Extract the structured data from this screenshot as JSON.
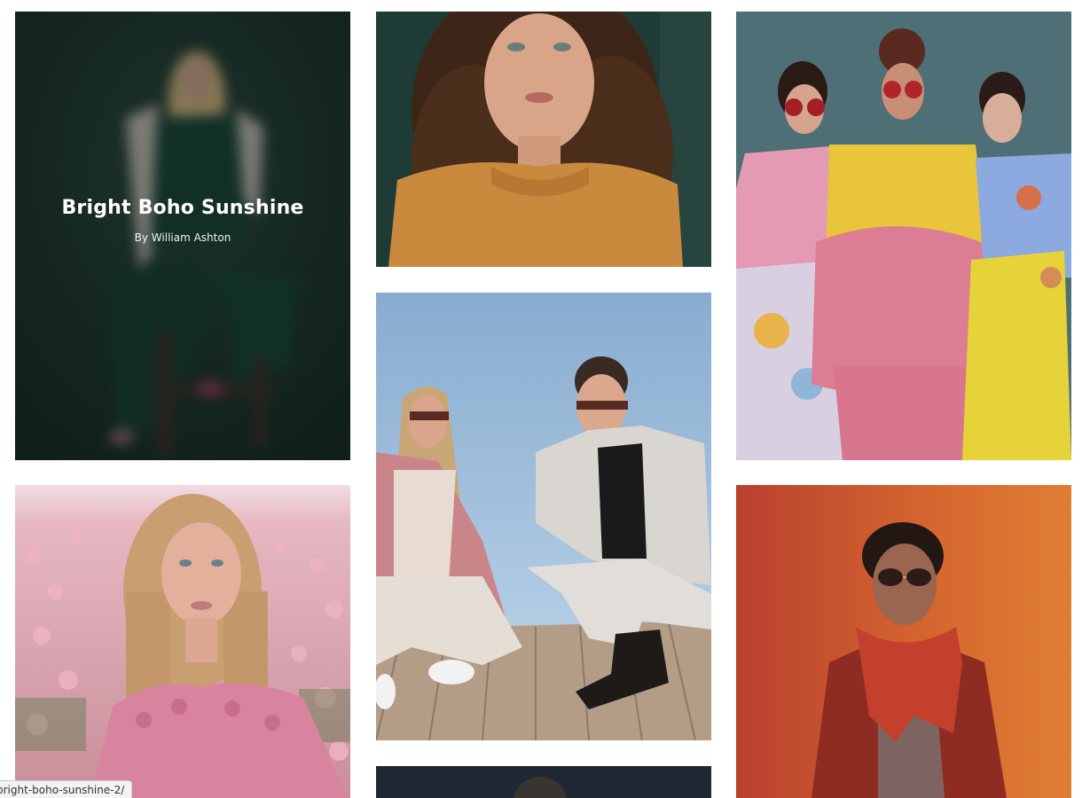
{
  "gallery": {
    "hover_card": {
      "title": "Bright Boho Sunshine",
      "author": "By William Ashton"
    },
    "items": [
      {
        "subject": "woman seated on stool in dark green outfit",
        "background": "#1c2d28"
      },
      {
        "subject": "woman with curly hair in mustard sweater",
        "background": "#1f3b36"
      },
      {
        "subject": "three models in colorful ruffled dresses with red sunglasses",
        "background": "#4f6f76"
      },
      {
        "subject": "blonde woman in pink blouse in flower field",
        "background": "#e7a9b4"
      },
      {
        "subject": "two models crouching on wooden deck with sunglasses",
        "background": "#8fb3d3"
      },
      {
        "subject": "man in red jacket and scarf with sunglasses",
        "background": "#c9562e"
      },
      {
        "subject": "partially visible portrait",
        "background": "#1d2833"
      }
    ]
  },
  "status_bar": {
    "url": "bright-boho-sunshine-2/"
  },
  "colors": {
    "page_background": "#ffffff",
    "overlay_text": "#ffffff"
  }
}
